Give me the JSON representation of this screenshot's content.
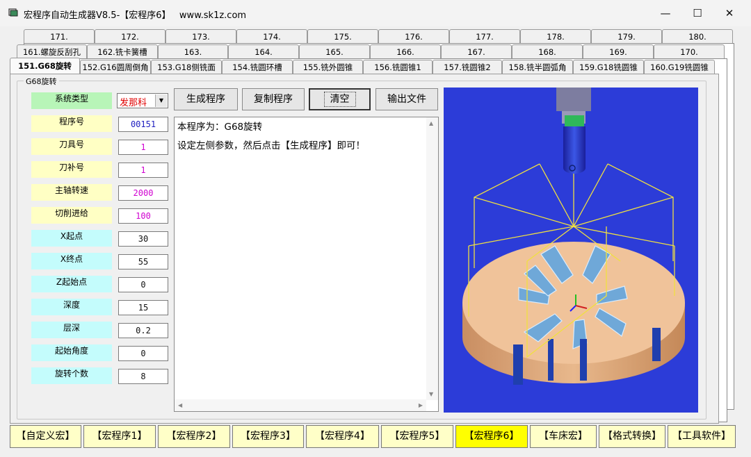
{
  "window": {
    "title": "宏程序自动生成器V8.5-【宏程序6】   www.sk1z.com",
    "minimize": "—",
    "maximize": "☐",
    "close": "✕"
  },
  "tabs": {
    "row1": [
      "171.",
      "172.",
      "173.",
      "174.",
      "175.",
      "176.",
      "177.",
      "178.",
      "179.",
      "180."
    ],
    "row2": [
      "161.螺旋反刮孔",
      "162.铣卡簧槽",
      "163.",
      "164.",
      "165.",
      "166.",
      "167.",
      "168.",
      "169.",
      "170."
    ],
    "row3": [
      "151.G68旋转",
      "152.G16圆周倒角",
      "153.G18侧铣面",
      "154.铣圆环槽",
      "155.铣外圆锥",
      "156.铣圆锥1",
      "157.铣圆锥2",
      "158.铣半圆弧角",
      "159.G18铣圆锥",
      "160.G19铣圆锥"
    ],
    "active": "151.G68旋转"
  },
  "group_label": "G68旋转",
  "params": [
    {
      "label": "系统类型",
      "value": "发那科",
      "type": "combo"
    },
    {
      "label": "程序号",
      "value": "00151"
    },
    {
      "label": "刀具号",
      "value": "1"
    },
    {
      "label": "刀补号",
      "value": "1"
    },
    {
      "label": "主轴转速",
      "value": "2000"
    },
    {
      "label": "切削进给",
      "value": "100"
    },
    {
      "label": "X起点",
      "value": "30"
    },
    {
      "label": "X终点",
      "value": "55"
    },
    {
      "label": "Z起始点",
      "value": "0"
    },
    {
      "label": "深度",
      "value": "15"
    },
    {
      "label": "层深",
      "value": "0.2"
    },
    {
      "label": "起始角度",
      "value": "0"
    },
    {
      "label": "旋转个数",
      "value": "8"
    }
  ],
  "actions": {
    "generate": "生成程序",
    "copy": "复制程序",
    "clear": "清空",
    "export": "输出文件"
  },
  "output": {
    "line1": "本程序为：G68旋转",
    "line2": "设定左侧参数，然后点击【生成程序】即可！"
  },
  "preview": {
    "description_icon": "3d-part-preview"
  },
  "nav": [
    "【自定义宏】",
    "【宏程序1】",
    "【宏程序2】",
    "【宏程序3】",
    "【宏程序4】",
    "【宏程序5】",
    "【宏程序6】",
    "【车床宏】",
    "【格式转换】",
    "【工具软件】"
  ],
  "nav_active": "【宏程序6】",
  "colors": {
    "label_green": "#b8f5b8",
    "label_yellow": "#ffffc4",
    "label_cyan": "#c4fcfc",
    "nav_bg": "#ffffc8",
    "nav_active": "#ffff00",
    "preview_bg": "#2c3cd8"
  }
}
